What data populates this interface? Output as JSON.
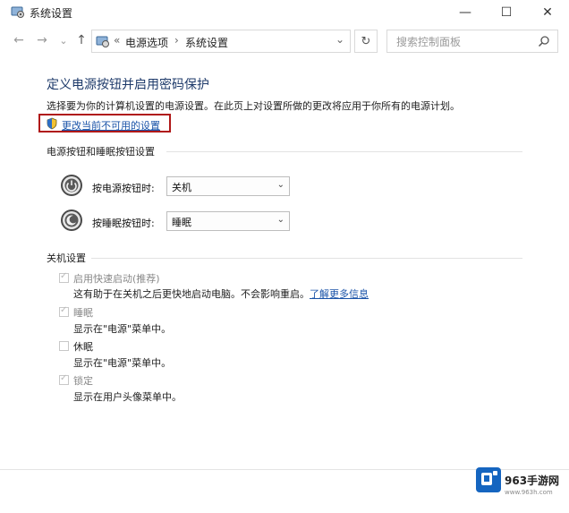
{
  "window": {
    "title": "系统设置",
    "minimize_glyph": "—",
    "maximize_glyph": "☐",
    "close_glyph": "✕"
  },
  "address_bar": {
    "back_glyph": "←",
    "forward_glyph": "→",
    "history_glyph": "⌄",
    "up_glyph": "↑",
    "overflow": "«",
    "crumbs": [
      "电源选项",
      "系统设置"
    ],
    "separator": "›",
    "dropdown_glyph": "⌄",
    "refresh_glyph": "↻",
    "search_placeholder": "搜索控制面板"
  },
  "page": {
    "title": "定义电源按钮并启用密码保护",
    "description": "选择要为你的计算机设置的电源设置。在此页上对设置所做的更改将应用于你所有的电源计划。",
    "change_settings_link": "更改当前不可用的设置"
  },
  "power_section": {
    "label": "电源按钮和睡眠按钮设置",
    "rows": [
      {
        "label": "按电源按钮时:",
        "value": "关机",
        "icon": "power-button-icon"
      },
      {
        "label": "按睡眠按钮时:",
        "value": "睡眠",
        "icon": "sleep-button-icon"
      }
    ]
  },
  "shutdown_section": {
    "label": "关机设置",
    "options": [
      {
        "label": "启用快速启动(推荐)",
        "checked": true,
        "desc": "这有助于在关机之后更快地启动电脑。不会影响重启。",
        "link": "了解更多信息"
      },
      {
        "label": "睡眠",
        "checked": true,
        "desc": "显示在\"电源\"菜单中。"
      },
      {
        "label": "休眠",
        "checked": false,
        "desc": "显示在\"电源\"菜单中。"
      },
      {
        "label": "锁定",
        "checked": true,
        "desc": "显示在用户头像菜单中。"
      }
    ]
  },
  "watermark": {
    "brand": "963手游网",
    "url": "www.963h.com"
  },
  "colors": {
    "title_blue": "#1e3a6a",
    "link_blue": "#1a53a8",
    "highlight_red": "#b01818"
  }
}
